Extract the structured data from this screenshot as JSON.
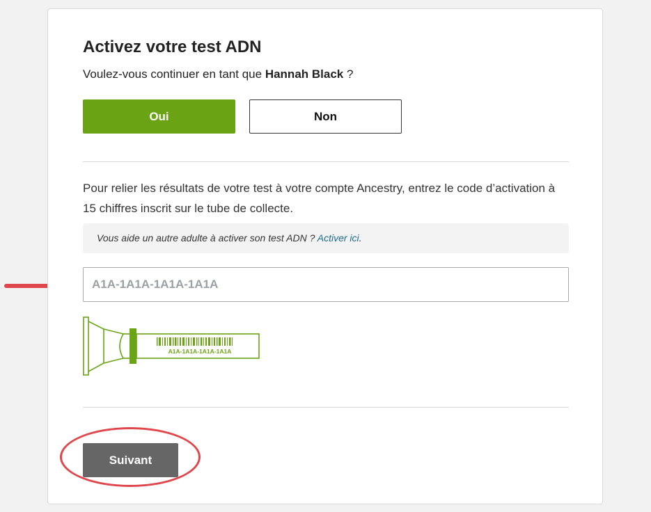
{
  "header": {
    "title": "Activez votre test ADN",
    "question_prefix": "Voulez-vous continuer en tant que",
    "user_name": "Hannah Black",
    "question_suffix": "?"
  },
  "choices": {
    "yes_label": "Oui",
    "no_label": "Non"
  },
  "activation": {
    "instructions": "Pour relier les résultats de votre test à votre compte Ancestry, entrez le code d’activation à 15 chiffres inscrit sur le tube de collecte.",
    "help_text": "Vous aide un autre adulte à activer son test ADN ?",
    "help_link": "Activer ici",
    "help_period": ".",
    "code_value": "",
    "code_placeholder": "A1A-1A1A-1A1A-1A1A",
    "tube_code": "A1A-1A1A-1A1A-1A1A"
  },
  "footer": {
    "next_label": "Suivant"
  },
  "colors": {
    "primary_green": "#6aa313",
    "next_button": "#666666",
    "annotation_red": "#e0474c",
    "link": "#1d6a8c"
  },
  "icons": {
    "tube": "collection-tube-icon",
    "arrow": "annotation-arrow-icon",
    "circle": "annotation-circle"
  }
}
